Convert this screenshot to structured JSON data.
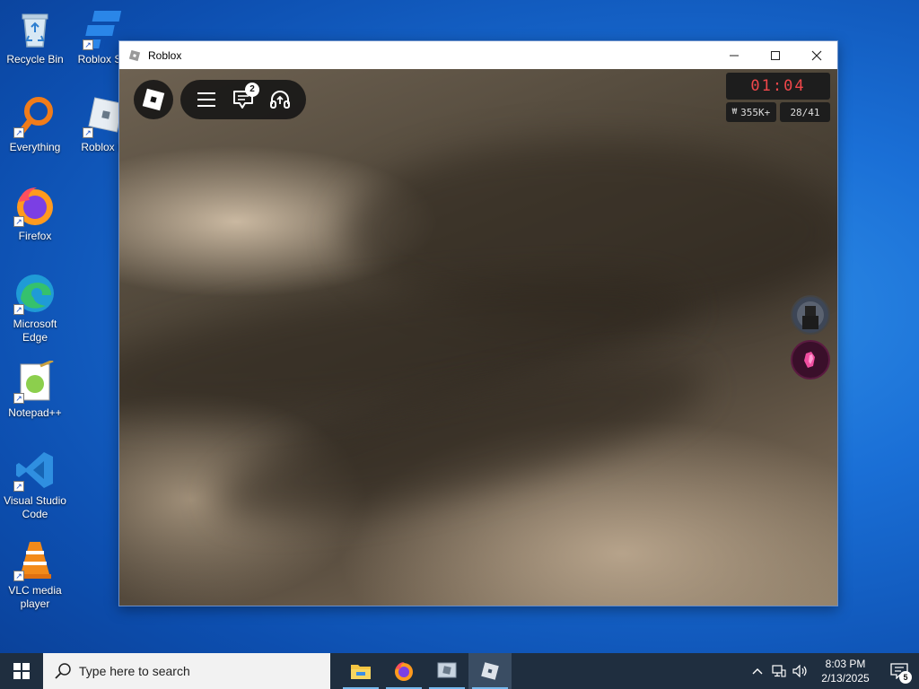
{
  "desktop": {
    "icons": [
      {
        "label": "Recycle Bin",
        "icon": "recycle-bin-icon"
      },
      {
        "label": "Roblox Stu",
        "icon": "roblox-studio-icon"
      },
      {
        "label": "Everything",
        "icon": "everything-search-icon"
      },
      {
        "label": "Roblox Pl",
        "icon": "roblox-player-icon"
      },
      {
        "label": "Firefox",
        "icon": "firefox-icon"
      },
      {
        "label": "Microsoft Edge",
        "icon": "edge-icon"
      },
      {
        "label": "Notepad++",
        "icon": "notepadpp-icon"
      },
      {
        "label": "Visual Studio Code",
        "icon": "vscode-icon"
      },
      {
        "label": "VLC media player",
        "icon": "vlc-icon"
      }
    ]
  },
  "window": {
    "title": "Roblox",
    "controls": {
      "minimize": "—",
      "maximize": "☐",
      "close": "✕"
    }
  },
  "game": {
    "chat_badge": "2",
    "timer": "01:04",
    "currency": "355K+",
    "player_count": "28/41",
    "side_buttons": [
      "player-avatar-icon",
      "emote-icon"
    ]
  },
  "taskbar": {
    "search_placeholder": "Type here to search",
    "apps": [
      "file-explorer-icon",
      "firefox-icon",
      "roblox-studio-icon",
      "roblox-icon"
    ],
    "clock_time": "8:03 PM",
    "clock_date": "2/13/2025",
    "notification_count": "5"
  },
  "colors": {
    "timer_text": "#f0474a",
    "taskbar_bg": "#1f2e3f",
    "desktop_blue": "#1a6fd6"
  }
}
